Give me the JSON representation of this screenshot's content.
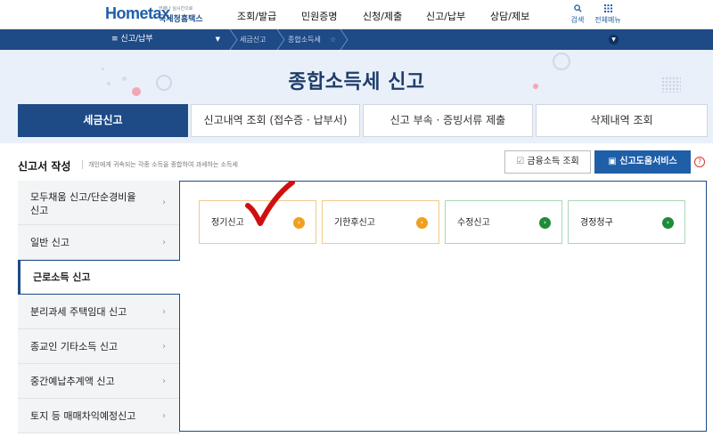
{
  "logo": {
    "brand": "Hometax",
    "brand_small": "e",
    "korean_name": "국세청홈택스",
    "tagline": "언제나 실시간으로"
  },
  "gnb": [
    "조회/발급",
    "민원증명",
    "신청/제출",
    "신고/납부",
    "상담/제보"
  ],
  "util": {
    "search": "검색",
    "all_menu": "전체메뉴"
  },
  "navbar": {
    "current_menu": "신고/납부",
    "crumb_1": "세금신고",
    "crumb_2": "종합소득세"
  },
  "hero": {
    "title": "종합소득세 신고"
  },
  "tabs": [
    "세금신고",
    "신고내역 조회 (접수증 · 납부서)",
    "신고 부속 · 증빙서류 제출",
    "삭제내역 조회"
  ],
  "section": {
    "title": "신고서 작성",
    "description": "개인에게 귀속되는 각종 소득을 종합하여 과세하는 소득세"
  },
  "buttons": {
    "finance_income": "금융소득 조회",
    "help_service": "신고도움서비스",
    "help_icon": "?"
  },
  "lnb": [
    {
      "label": "모두채움 신고/단순경비율 신고"
    },
    {
      "label": "일반 신고"
    },
    {
      "label": "근로소득 신고"
    },
    {
      "label": "분리과세 주택임대 신고"
    },
    {
      "label": "종교인 기타소득 신고"
    },
    {
      "label": "중간예납추계액 신고"
    },
    {
      "label": "토지 등 매매차익예정신고"
    }
  ],
  "cards": [
    {
      "label": "정기신고",
      "color": "#f0a020"
    },
    {
      "label": "기한후신고",
      "color": "#f0a020"
    },
    {
      "label": "수정신고",
      "color": "#1f8a3a"
    },
    {
      "label": "경정청구",
      "color": "#1f8a3a"
    }
  ],
  "colors": {
    "navy": "#1e4a86",
    "accent_blue": "#1f5fa8",
    "check_red": "#d01010"
  }
}
